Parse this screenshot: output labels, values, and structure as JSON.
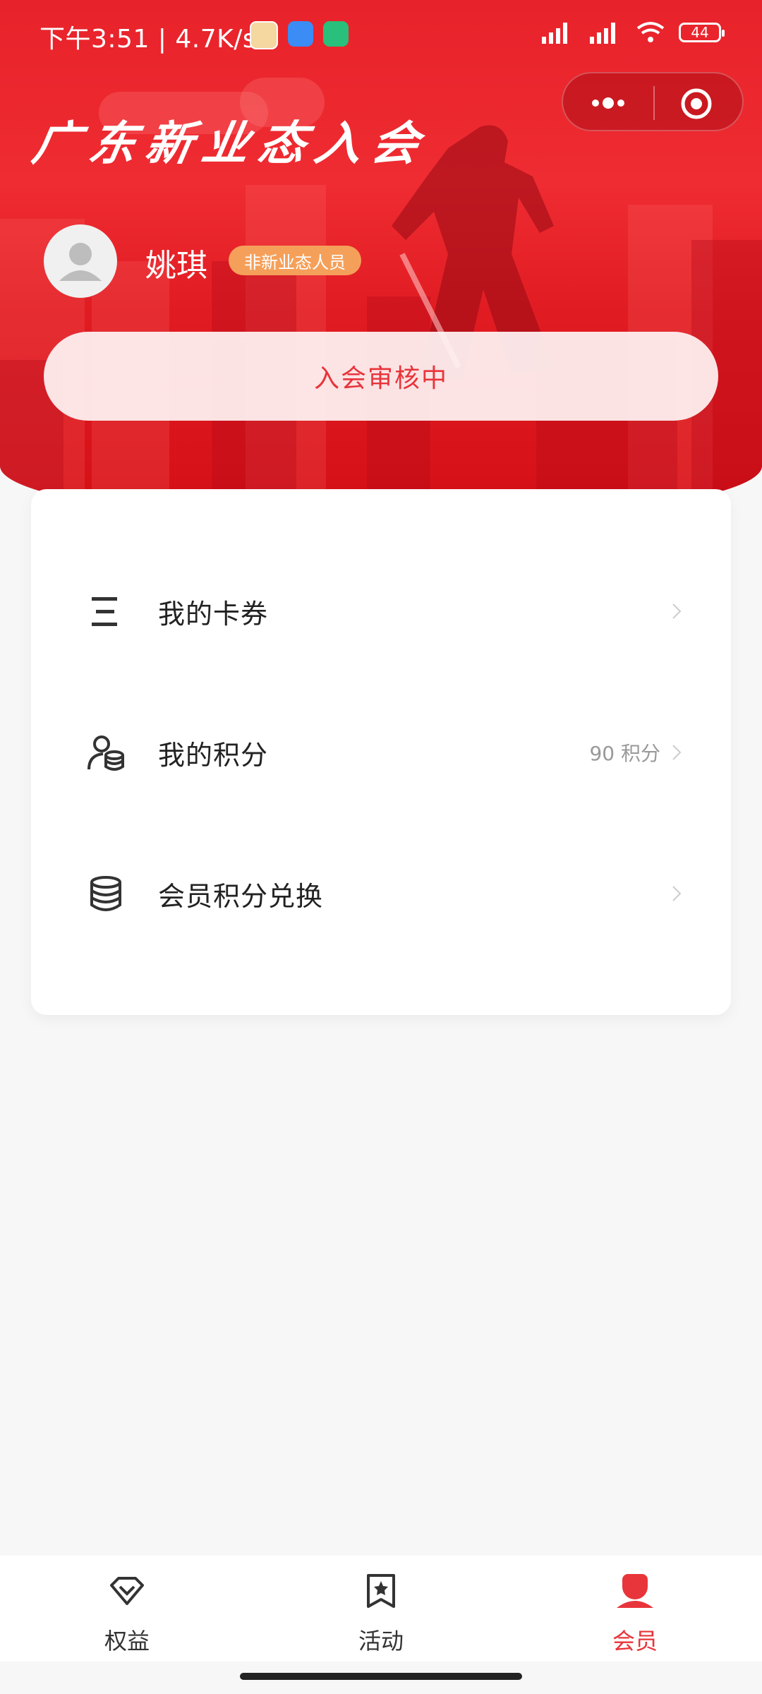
{
  "status_bar": {
    "time": "下午3:51 | 4.7K/s",
    "battery": "44"
  },
  "header": {
    "title": "广东新业态入会"
  },
  "profile": {
    "name": "姚琪",
    "tag": "非新业态人员",
    "application_status": "入会审核中"
  },
  "menu": {
    "items": [
      {
        "label": "我的卡券",
        "value": "",
        "icon": "list-icon"
      },
      {
        "label": "我的积分",
        "value": "90 积分",
        "icon": "points-icon"
      },
      {
        "label": "会员积分兑换",
        "value": "",
        "icon": "database-icon"
      }
    ]
  },
  "tabbar": {
    "tabs": [
      {
        "label": "权益",
        "icon": "diamond-icon",
        "active": false
      },
      {
        "label": "活动",
        "icon": "bookmark-star-icon",
        "active": false
      },
      {
        "label": "会员",
        "icon": "person-icon",
        "active": true
      }
    ]
  },
  "colors": {
    "brand_red": "#e8343b",
    "tag_orange": "#f5a05a"
  }
}
